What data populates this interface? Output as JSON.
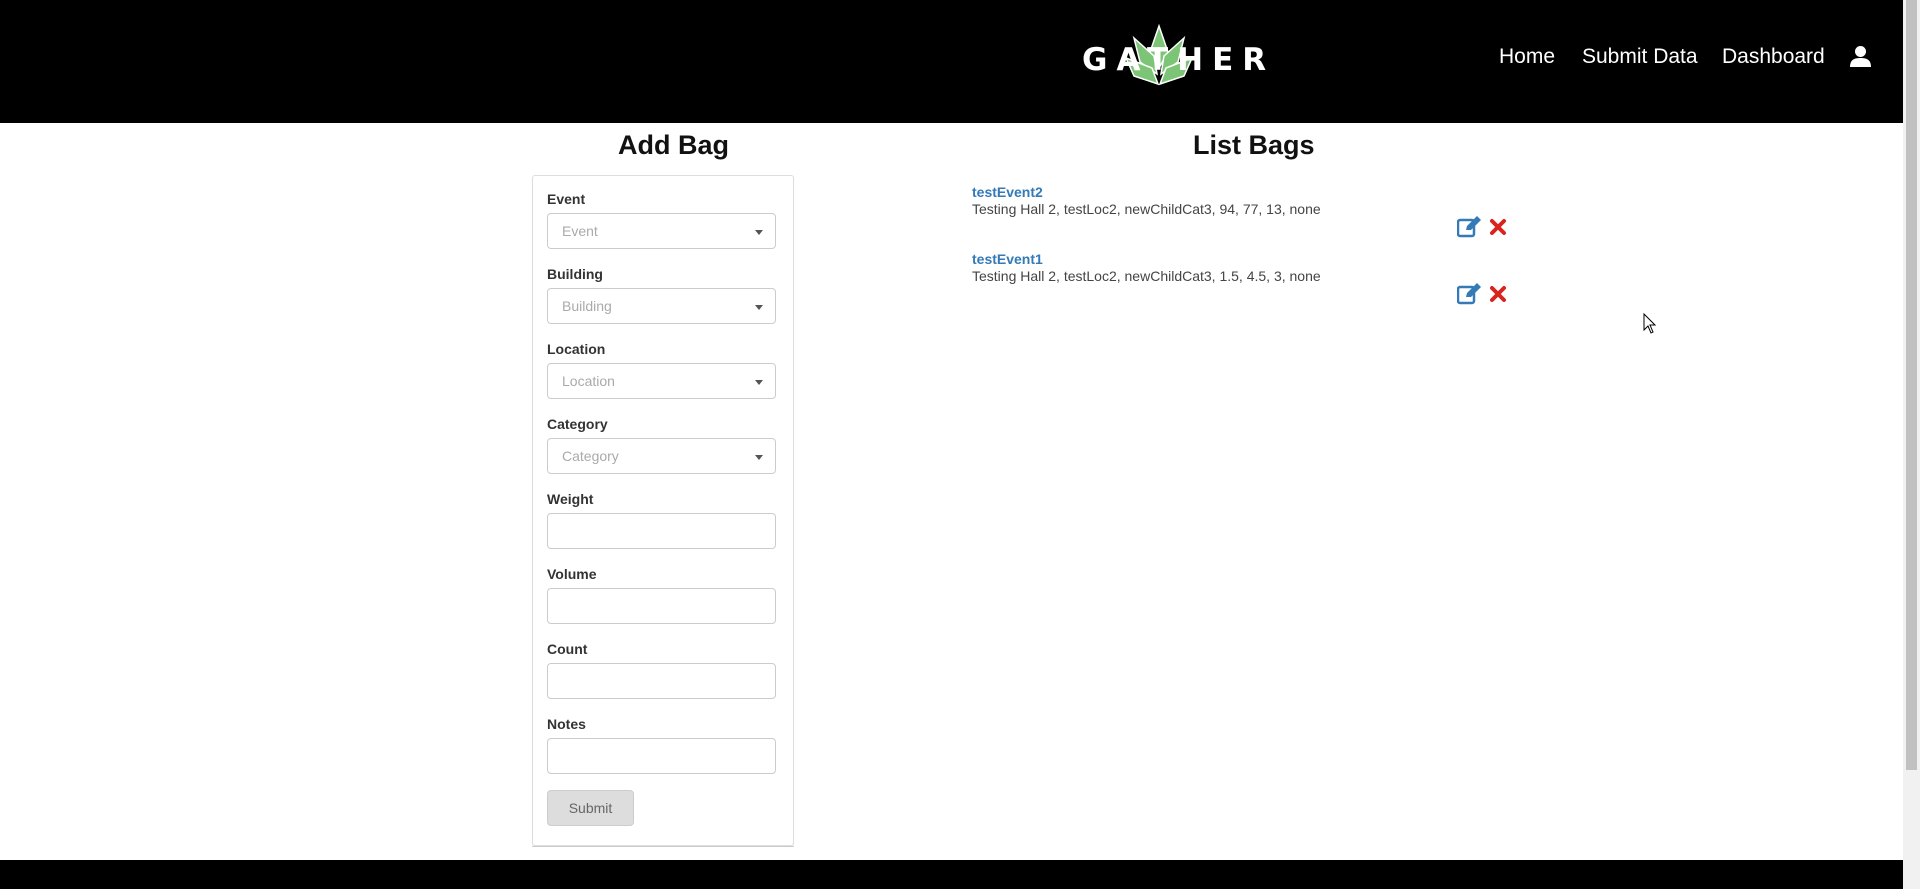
{
  "brand": {
    "logo_text": "GATHER",
    "accent_green": "#7cc576"
  },
  "nav": {
    "home": "Home",
    "submit_data": "Submit Data",
    "dashboard": "Dashboard",
    "user_icon": "user-icon"
  },
  "add_bag": {
    "title": "Add Bag",
    "fields": {
      "event": {
        "label": "Event",
        "placeholder": "Event"
      },
      "building": {
        "label": "Building",
        "placeholder": "Building"
      },
      "location": {
        "label": "Location",
        "placeholder": "Location"
      },
      "category": {
        "label": "Category",
        "placeholder": "Category"
      },
      "weight": {
        "label": "Weight",
        "value": ""
      },
      "volume": {
        "label": "Volume",
        "value": ""
      },
      "count": {
        "label": "Count",
        "value": ""
      },
      "notes": {
        "label": "Notes",
        "value": ""
      }
    },
    "submit_label": "Submit"
  },
  "list_bags": {
    "title": "List Bags",
    "items": [
      {
        "event": "testEvent2",
        "details": "Testing Hall 2, testLoc2, newChildCat3, 94, 77, 13, none"
      },
      {
        "event": "testEvent1",
        "details": "Testing Hall 2, testLoc2, newChildCat3, 1.5, 4.5, 3, none"
      }
    ],
    "edit_icon": "edit-icon",
    "delete_icon": "delete-icon",
    "edit_color": "#337ab7",
    "delete_color": "#d9231d"
  }
}
